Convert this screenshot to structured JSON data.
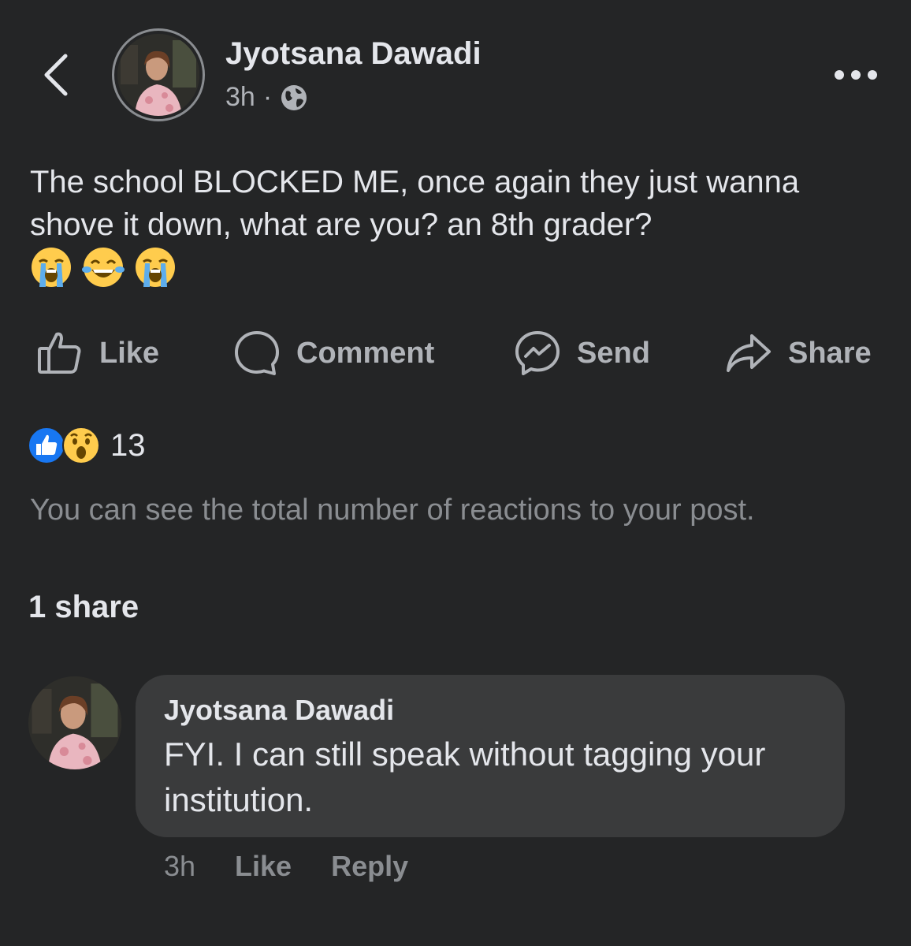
{
  "post": {
    "author": "Jyotsana Dawadi",
    "time": "3h",
    "separator": "·",
    "privacy_icon": "globe-icon",
    "text": "The school BLOCKED ME, once again they just wanna shove it down, what are you?  an 8th grader?",
    "emojis": [
      "loudly-crying-face",
      "face-with-tears-of-joy",
      "loudly-crying-face"
    ]
  },
  "actions": {
    "like": "Like",
    "comment": "Comment",
    "send": "Send",
    "share": "Share"
  },
  "reactions": {
    "icons": [
      "like-reaction-icon",
      "wow-reaction-icon"
    ],
    "count": "13",
    "note": "You can see the total number of reactions to your post."
  },
  "shares": "1 share",
  "comment": {
    "author": "Jyotsana Dawadi",
    "line1": "FYI. I can still speak without tagging your",
    "line2": "institution.",
    "time": "3h",
    "like": "Like",
    "reply": "Reply"
  },
  "colors": {
    "background": "#242526",
    "text_primary": "#e4e6eb",
    "text_secondary": "#b0b3b8",
    "bubble": "#3a3b3c",
    "like_blue": "#1877f2",
    "emoji_yellow": "#ffcc4d"
  }
}
